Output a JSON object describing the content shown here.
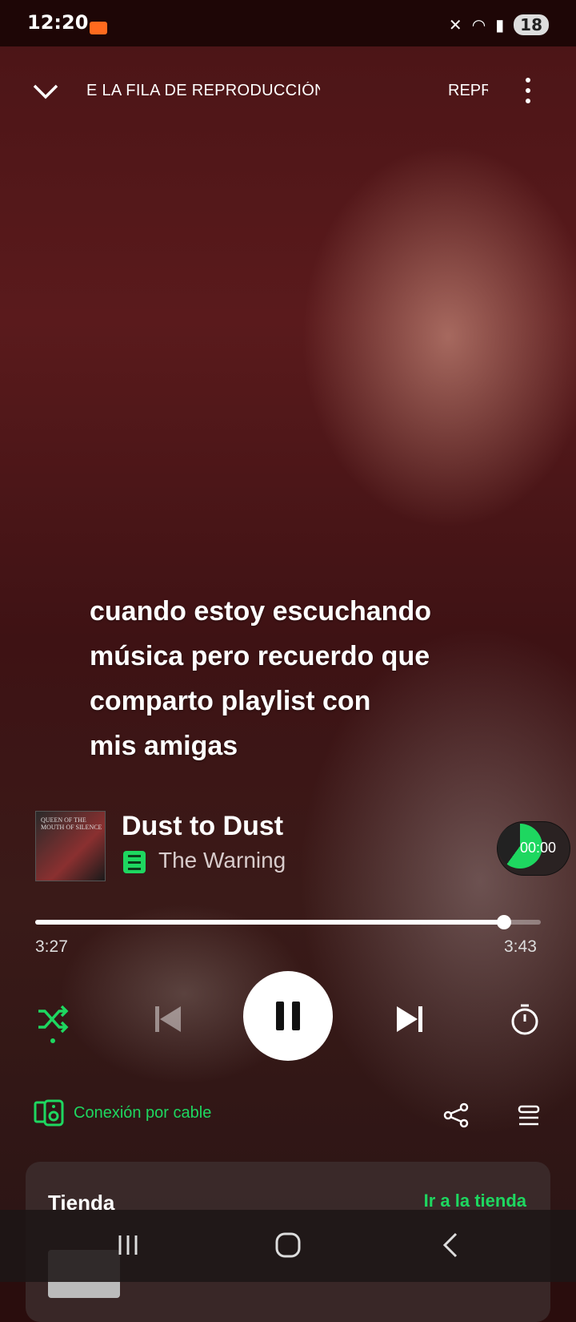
{
  "status_bar": {
    "time": "12:20",
    "battery": "18",
    "icons": [
      "screen-record-icon",
      "mute-icon",
      "wifi-icon",
      "signal-icon",
      "battery-icon"
    ]
  },
  "header": {
    "queue_title": "E LA FILA DE REPRODUCCIÓN",
    "queue_title_2": "REPR"
  },
  "caption": {
    "line1": "cuando estoy escuchando",
    "line2": "música pero recuerdo que",
    "line3": "comparto playlist con",
    "line4": "mis amigas"
  },
  "track": {
    "title": "Dust to Dust",
    "artist": "The Warning",
    "album_art_text": "QUEEN OF THE MOUTH OF SILENCE"
  },
  "sleep_timer_chip": "00:00",
  "progress": {
    "elapsed": "3:27",
    "total": "3:43",
    "fraction": 0.928
  },
  "device": {
    "label": "Conexión por cable"
  },
  "shop": {
    "title": "Tienda",
    "link": "Ir a la tienda"
  },
  "colors": {
    "accent": "#1ed760",
    "status_bar_bg": "#1e0606"
  }
}
